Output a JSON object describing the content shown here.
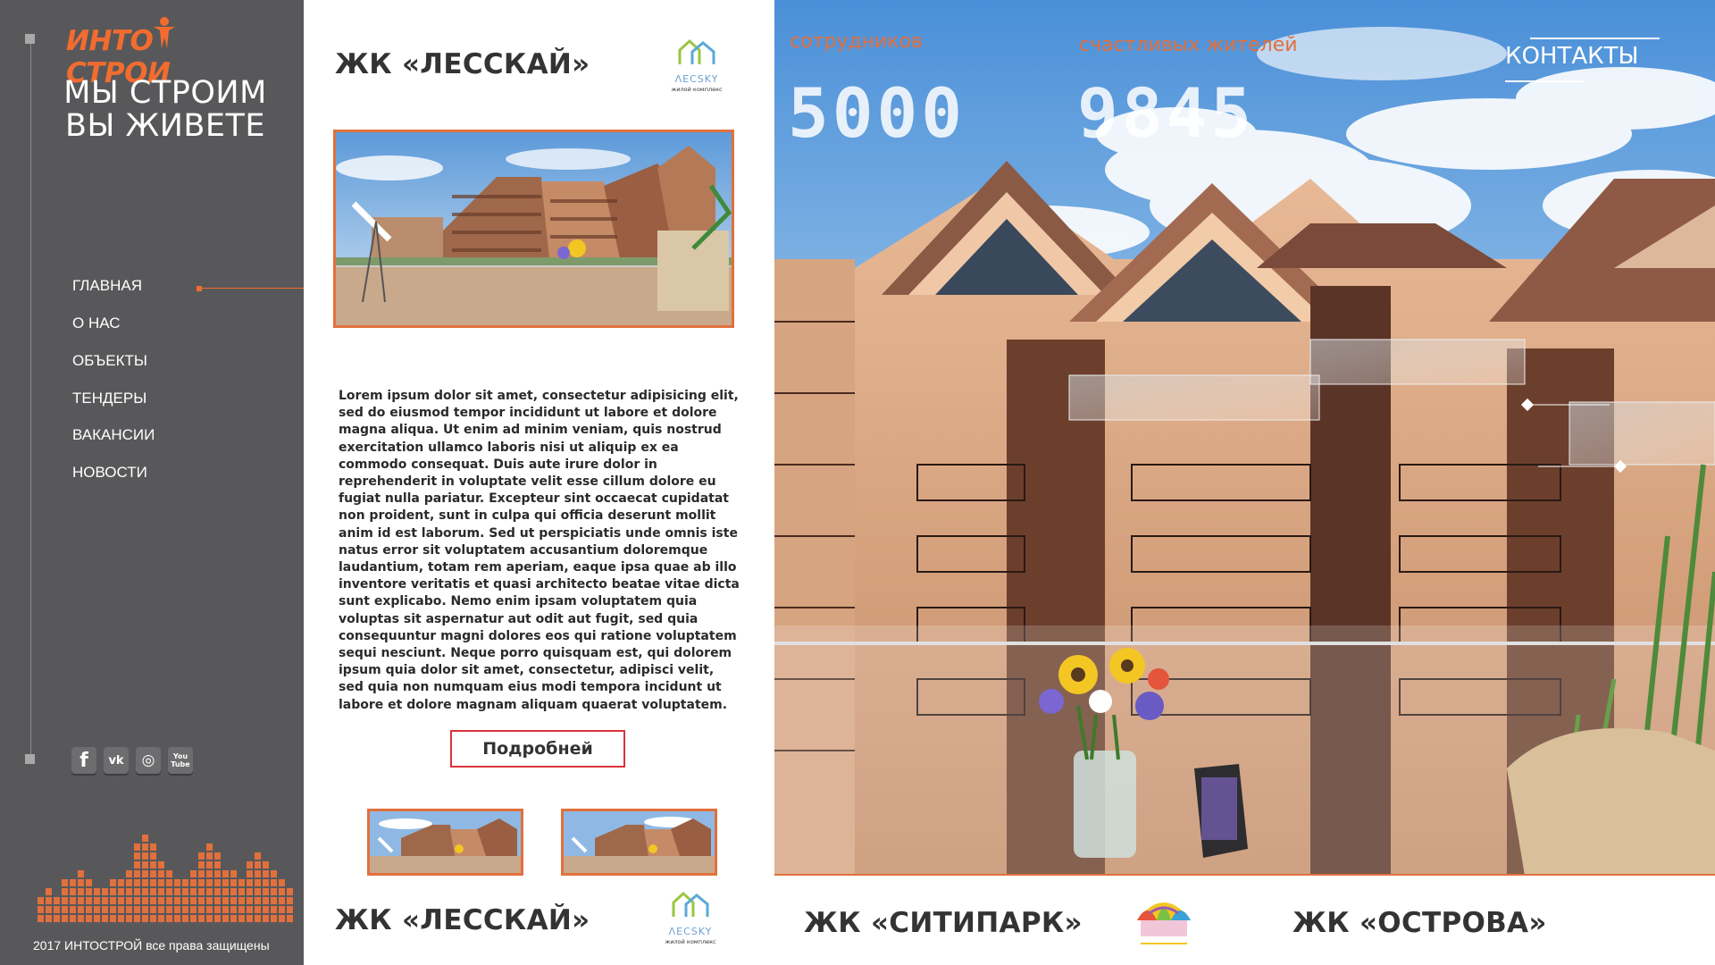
{
  "brand": {
    "logo_left": "ИНТО",
    "logo_right": "СТРОИ",
    "slogan_line1": "МЫ СТРОИМ",
    "slogan_line2": "ВЫ ЖИВЕТЕ",
    "accent_color": "#e2703c"
  },
  "nav": {
    "items": [
      {
        "label": "ГЛАВНАЯ",
        "active": true
      },
      {
        "label": "О НАС"
      },
      {
        "label": "ОБЪЕКТЫ"
      },
      {
        "label": "ТЕНДЕРЫ"
      },
      {
        "label": "ВАКАНСИИ"
      },
      {
        "label": "НОВОСТИ"
      }
    ]
  },
  "social": {
    "items": [
      {
        "name": "facebook-icon",
        "glyph": "f"
      },
      {
        "name": "vk-icon",
        "glyph": "vk"
      },
      {
        "name": "instagram-icon",
        "glyph": "◎"
      },
      {
        "name": "youtube-icon",
        "glyph": "You Tube"
      }
    ]
  },
  "footer": {
    "copyright": "2017 ИНТОСТРОЙ все права защищены"
  },
  "project": {
    "title": "ЖК «ЛЕССКАЙ»",
    "logo_text": "ΛECSKY",
    "logo_sub": "жилой комплекс",
    "description": "Lorem ipsum dolor sit amet, consectetur adipisicing elit, sed do eiusmod tempor incididunt ut labore et dolore magna aliqua. Ut enim ad minim veniam, quis nostrud exercitation ullamco laboris nisi ut aliquip ex ea commodo consequat. Duis aute irure dolor in reprehenderit in voluptate velit esse cillum dolore eu fugiat nulla pariatur. Excepteur sint occaecat cupidatat non proident, sunt in culpa qui officia deserunt mollit anim id est laborum. Sed ut perspiciatis unde omnis iste natus error sit voluptatem accusantium doloremque laudantium, totam rem aperiam, eaque ipsa quae ab illo inventore veritatis et quasi architecto beatae vitae dicta sunt explicabo. Nemo enim ipsam voluptatem quia voluptas sit aspernatur aut odit aut fugit, sed quia consequuntur magni dolores eos qui ratione voluptatem sequi nesciunt. Neque porro quisquam est, qui dolorem ipsum quia dolor sit amet, consectetur, adipisci velit, sed quia non numquam eius modi tempora incidunt ut labore et dolore magnam aliquam quaerat voluptatem.",
    "more_button": "Подробней"
  },
  "stats": {
    "employees_label": "сотрудников",
    "employees_value": "5000",
    "residents_label": "счастливых жителей",
    "residents_value": "9845"
  },
  "header": {
    "contacts": "КОНТАКТЫ"
  },
  "bottom_projects": [
    {
      "title": "ЖК «ЛЕССКАЙ»",
      "logo": "lesky-logo"
    },
    {
      "title": "ЖК «СИТИПАРК»",
      "logo": "citypark-logo"
    },
    {
      "title": "ЖК «ОСТРОВА»",
      "logo": ""
    }
  ]
}
